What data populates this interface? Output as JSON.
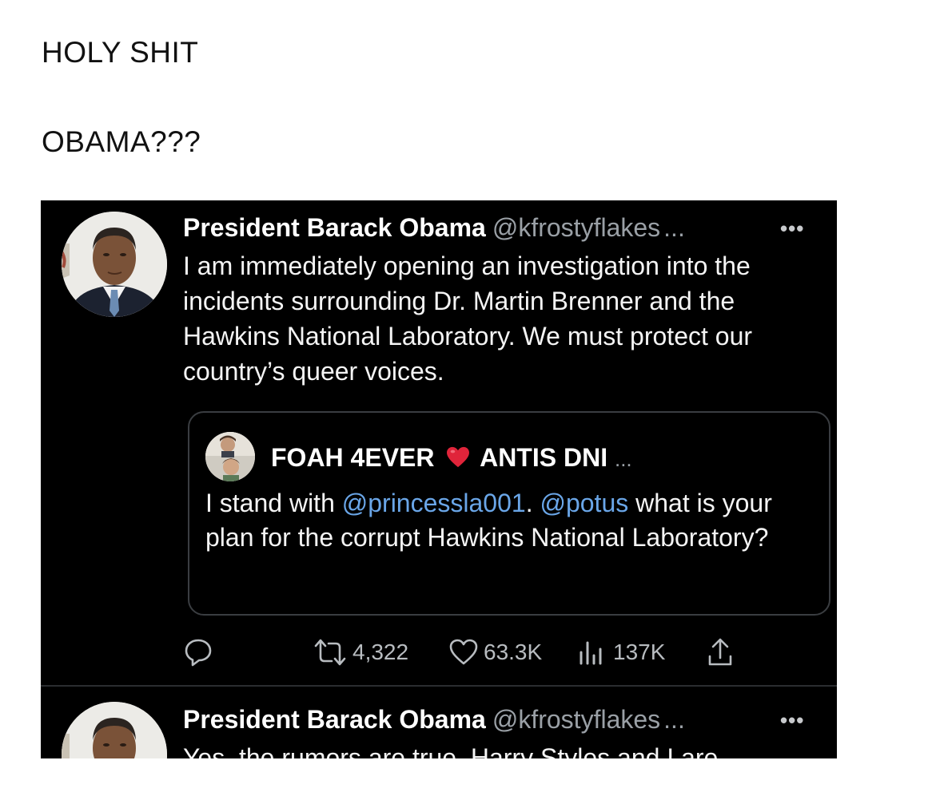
{
  "caption": {
    "line1": "HOLY SHIT",
    "line2": "OBAMA???"
  },
  "tweet1": {
    "display_name": "President Barack Obama",
    "handle": "@kfrostyflakes",
    "truncation": "...",
    "more_icon": "•••",
    "text": "I am immediately opening an investigation into the incidents surrounding Dr. Martin Brenner and the Hawkins National Laboratory. We must protect our country’s queer voices.",
    "quote": {
      "name_part1": "FOAH 4EVER",
      "heart_emoji_name": "red-heart",
      "name_part2": "ANTIS DNI",
      "truncation": "...",
      "text_before": "I stand with ",
      "mention1": "@princessla001",
      "text_middle": ". ",
      "mention2": "@potus",
      "text_after": " what is your plan for the corrupt Hawkins National Laboratory?"
    },
    "actions": {
      "reply_icon": "reply-icon",
      "retweets": "4,322",
      "likes": "63.3K",
      "views": "137K",
      "share_icon": "share-icon"
    }
  },
  "tweet2": {
    "display_name": "President Barack Obama",
    "handle": "@kfrostyflakes",
    "truncation": "...",
    "more_icon": "•••",
    "text_partial": "Yes, the rumors are true. Harry Styles and I are"
  },
  "colors": {
    "background": "#000000",
    "mention": "#6aa6e8",
    "muted": "#9aa0a6",
    "heart": "#e0243a"
  }
}
